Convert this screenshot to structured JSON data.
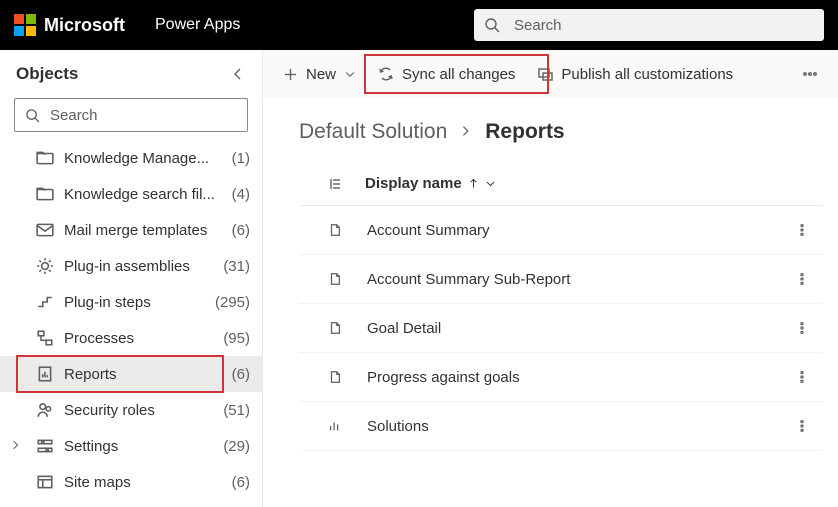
{
  "topbar": {
    "brand": "Microsoft",
    "app": "Power Apps",
    "search_placeholder": "Search"
  },
  "sidebar": {
    "title": "Objects",
    "search_placeholder": "Search",
    "items": [
      {
        "icon": "folder",
        "label": "Knowledge Manage...",
        "count": "(1)"
      },
      {
        "icon": "folder",
        "label": "Knowledge search fil...",
        "count": "(4)"
      },
      {
        "icon": "mail",
        "label": "Mail merge templates",
        "count": "(6)"
      },
      {
        "icon": "gear",
        "label": "Plug-in assemblies",
        "count": "(31)"
      },
      {
        "icon": "step",
        "label": "Plug-in steps",
        "count": "(295)"
      },
      {
        "icon": "flow",
        "label": "Processes",
        "count": "(95)"
      },
      {
        "icon": "report",
        "label": "Reports",
        "count": "(6)",
        "selected": true
      },
      {
        "icon": "roles",
        "label": "Security roles",
        "count": "(51)"
      },
      {
        "icon": "settings",
        "label": "Settings",
        "count": "(29)",
        "expandable": true
      },
      {
        "icon": "sitemap",
        "label": "Site maps",
        "count": "(6)"
      }
    ]
  },
  "commands": {
    "new": "New",
    "sync": "Sync all changes",
    "publish": "Publish all customizations"
  },
  "breadcrumb": {
    "parent": "Default Solution",
    "current": "Reports"
  },
  "table": {
    "column": "Display name",
    "rows": [
      {
        "icon": "file",
        "name": "Account Summary"
      },
      {
        "icon": "file",
        "name": "Account Summary Sub-Report"
      },
      {
        "icon": "file",
        "name": "Goal Detail"
      },
      {
        "icon": "file",
        "name": "Progress against goals"
      },
      {
        "icon": "chart",
        "name": "Solutions"
      }
    ]
  }
}
